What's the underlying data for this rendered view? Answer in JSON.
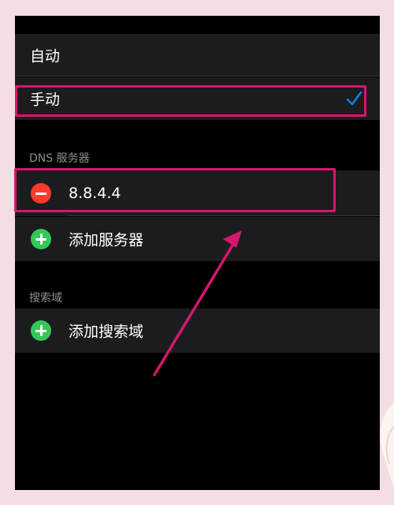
{
  "proxy_mode": {
    "options": [
      {
        "label": "自动",
        "selected": false
      },
      {
        "label": "手动",
        "selected": true
      }
    ]
  },
  "dns": {
    "header": "DNS 服务器",
    "servers": [
      "8.8.4.4"
    ],
    "add_label": "添加服务器"
  },
  "search_domains": {
    "header": "搜索域",
    "add_label": "添加搜索域"
  },
  "icons": {
    "selected": "checkmark-icon",
    "remove": "minus-circle-icon",
    "add": "plus-circle-icon"
  },
  "colors": {
    "accent": "#0a84ff",
    "remove": "#ff3b30",
    "add": "#34c759",
    "annotation": "#d6166f"
  }
}
